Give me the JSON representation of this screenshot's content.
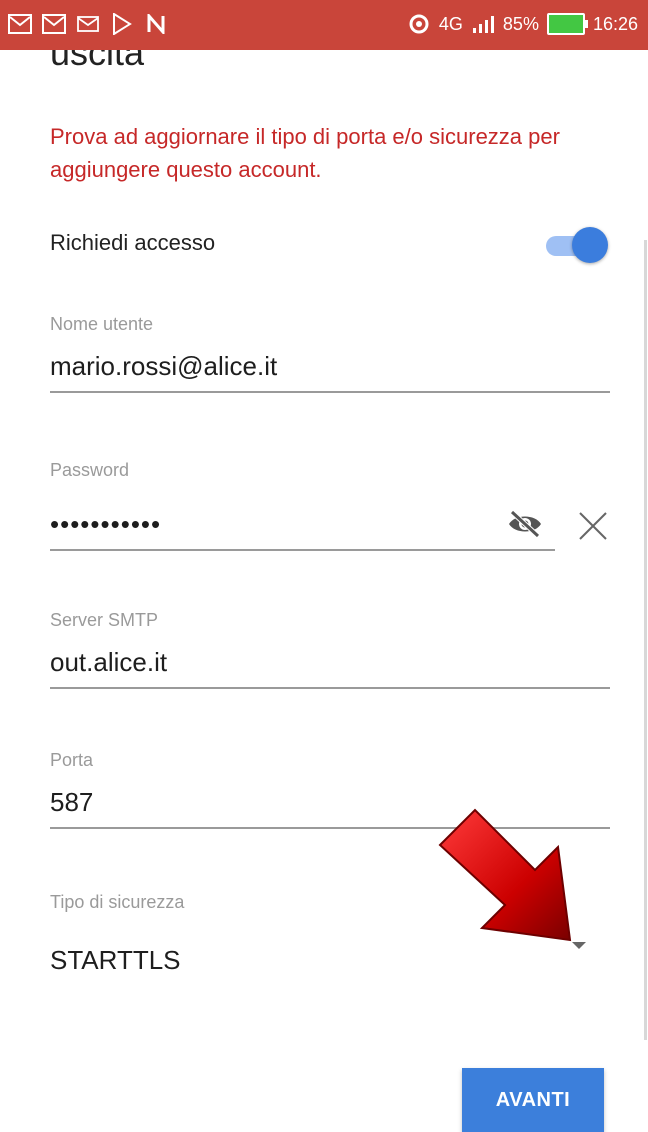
{
  "status_bar": {
    "network": "4G",
    "battery": "85%",
    "time": "16:26",
    "icons": [
      "gmail-icon",
      "gmail-icon",
      "email-icon",
      "play-store-icon",
      "n-icon",
      "sync-icon",
      "signal-icon",
      "battery-charging-icon"
    ]
  },
  "header": {
    "title_partial": "uscita"
  },
  "error_message": "Prova ad aggiornare il tipo di porta e/o sicurezza per aggiungere questo account.",
  "require_signin": {
    "label": "Richiedi accesso",
    "enabled": true
  },
  "username": {
    "label": "Nome utente",
    "value": "mario.rossi@alice.it"
  },
  "password": {
    "label": "Password",
    "value": "•••••••••••"
  },
  "smtp_server": {
    "label": "Server SMTP",
    "value": "out.alice.it"
  },
  "port": {
    "label": "Porta",
    "value": "587"
  },
  "security_type": {
    "label": "Tipo di sicurezza",
    "value": "STARTTLS"
  },
  "next_button": {
    "label": "AVANTI"
  },
  "colors": {
    "status_bar": "#c9453a",
    "error_text": "#c62828",
    "accent": "#3c7fdb",
    "annotation_arrow": "#cc0000"
  }
}
